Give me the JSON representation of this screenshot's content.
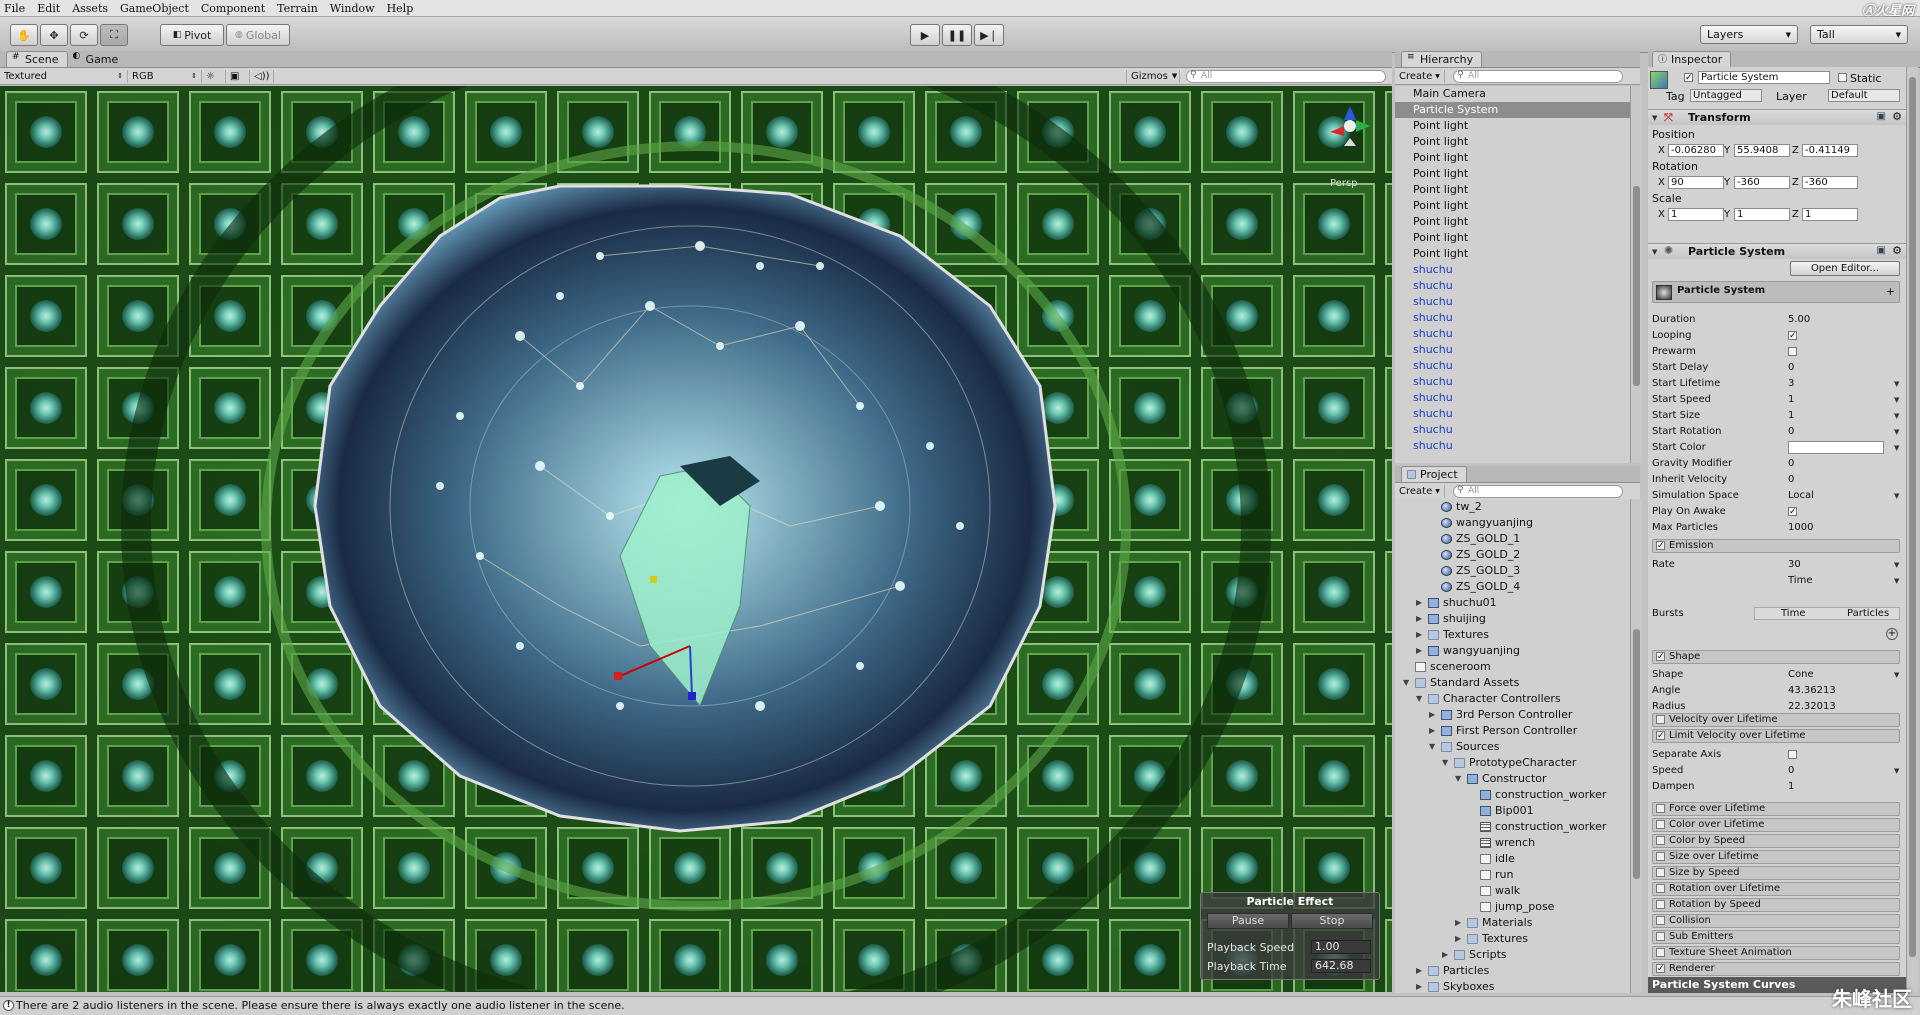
{
  "menu": [
    "File",
    "Edit",
    "Assets",
    "GameObject",
    "Component",
    "Terrain",
    "Window",
    "Help"
  ],
  "watermark_top": "Ⓐ火星网",
  "toolbar": {
    "pivot": "Pivot",
    "global": "Global",
    "layers": "Layers",
    "layout": "Tall"
  },
  "scene_tabs": {
    "scene": "Scene",
    "game": "Game"
  },
  "scene_bar": {
    "render": "Textured",
    "color": "RGB",
    "gizmos": "Gizmos",
    "search": "All",
    "persp": "Persp"
  },
  "hierarchy": {
    "title": "Hierarchy",
    "create": "Create",
    "search": "All",
    "items": [
      {
        "label": "Main Camera",
        "state": ""
      },
      {
        "label": "Particle System",
        "state": "sel"
      },
      {
        "label": "Point light",
        "state": ""
      },
      {
        "label": "Point light",
        "state": ""
      },
      {
        "label": "Point light",
        "state": ""
      },
      {
        "label": "Point light",
        "state": ""
      },
      {
        "label": "Point light",
        "state": ""
      },
      {
        "label": "Point light",
        "state": ""
      },
      {
        "label": "Point light",
        "state": ""
      },
      {
        "label": "Point light",
        "state": ""
      },
      {
        "label": "Point light",
        "state": ""
      },
      {
        "label": "shuchu",
        "state": "blue"
      },
      {
        "label": "shuchu",
        "state": "blue"
      },
      {
        "label": "shuchu",
        "state": "blue"
      },
      {
        "label": "shuchu",
        "state": "blue"
      },
      {
        "label": "shuchu",
        "state": "blue"
      },
      {
        "label": "shuchu",
        "state": "blue"
      },
      {
        "label": "shuchu",
        "state": "blue"
      },
      {
        "label": "shuchu",
        "state": "blue"
      },
      {
        "label": "shuchu",
        "state": "blue"
      },
      {
        "label": "shuchu",
        "state": "blue"
      },
      {
        "label": "shuchu",
        "state": "blue"
      },
      {
        "label": "shuchu",
        "state": "blue"
      }
    ]
  },
  "project": {
    "title": "Project",
    "create": "Create",
    "search": "All",
    "items": [
      {
        "label": "tw_2",
        "indent": 2,
        "icon": "ball",
        "arrow": ""
      },
      {
        "label": "wangyuanjing",
        "indent": 2,
        "icon": "ball",
        "arrow": ""
      },
      {
        "label": "ZS_GOLD_1",
        "indent": 2,
        "icon": "ball",
        "arrow": ""
      },
      {
        "label": "ZS_GOLD_2",
        "indent": 2,
        "icon": "ball",
        "arrow": ""
      },
      {
        "label": "ZS_GOLD_3",
        "indent": 2,
        "icon": "ball",
        "arrow": ""
      },
      {
        "label": "ZS_GOLD_4",
        "indent": 2,
        "icon": "ball",
        "arrow": ""
      },
      {
        "label": "shuchu01",
        "indent": 1,
        "icon": "prefab",
        "arrow": "▶"
      },
      {
        "label": "shuijing",
        "indent": 1,
        "icon": "prefab",
        "arrow": "▶"
      },
      {
        "label": "Textures",
        "indent": 1,
        "icon": "folder",
        "arrow": "▶"
      },
      {
        "label": "wangyuanjing",
        "indent": 1,
        "icon": "prefab",
        "arrow": "▶"
      },
      {
        "label": "sceneroom",
        "indent": 0,
        "icon": "doc",
        "arrow": ""
      },
      {
        "label": "Standard Assets",
        "indent": 0,
        "icon": "folder",
        "arrow": "▼"
      },
      {
        "label": "Character Controllers",
        "indent": 1,
        "icon": "folder",
        "arrow": "▼"
      },
      {
        "label": "3rd Person Controller",
        "indent": 2,
        "icon": "prefab",
        "arrow": "▶"
      },
      {
        "label": "First Person Controller",
        "indent": 2,
        "icon": "prefab",
        "arrow": "▶"
      },
      {
        "label": "Sources",
        "indent": 2,
        "icon": "folder",
        "arrow": "▼"
      },
      {
        "label": "PrototypeCharacter",
        "indent": 3,
        "icon": "folder",
        "arrow": "▼"
      },
      {
        "label": "Constructor",
        "indent": 4,
        "icon": "prefab",
        "arrow": "▼"
      },
      {
        "label": "construction_worker",
        "indent": 5,
        "icon": "prefab",
        "arrow": ""
      },
      {
        "label": "Bip001",
        "indent": 5,
        "icon": "prefab",
        "arrow": ""
      },
      {
        "label": "construction_worker",
        "indent": 5,
        "icon": "grid3",
        "arrow": ""
      },
      {
        "label": "wrench",
        "indent": 5,
        "icon": "grid3",
        "arrow": ""
      },
      {
        "label": "idle",
        "indent": 5,
        "icon": "doc",
        "arrow": ""
      },
      {
        "label": "run",
        "indent": 5,
        "icon": "doc",
        "arrow": ""
      },
      {
        "label": "walk",
        "indent": 5,
        "icon": "doc",
        "arrow": ""
      },
      {
        "label": "jump_pose",
        "indent": 5,
        "icon": "doc",
        "arrow": ""
      },
      {
        "label": "Materials",
        "indent": 4,
        "icon": "folder",
        "arrow": "▶"
      },
      {
        "label": "Textures",
        "indent": 4,
        "icon": "folder",
        "arrow": "▶"
      },
      {
        "label": "Scripts",
        "indent": 3,
        "icon": "folder",
        "arrow": "▶"
      },
      {
        "label": "Particles",
        "indent": 1,
        "icon": "folder",
        "arrow": "▶"
      },
      {
        "label": "Skyboxes",
        "indent": 1,
        "icon": "folder",
        "arrow": "▶"
      }
    ]
  },
  "inspector": {
    "title": "Inspector",
    "object_name": "Particle System",
    "static_label": "Static",
    "tag_label": "Tag",
    "tag_value": "Untagged",
    "layer_label": "Layer",
    "layer_value": "Default",
    "transform": {
      "title": "Transform",
      "position_label": "Position",
      "rotation_label": "Rotation",
      "scale_label": "Scale",
      "axes": [
        "X",
        "Y",
        "Z"
      ],
      "position": [
        "-0.06280",
        "55.9408",
        "-0.41149"
      ],
      "rotation": [
        "90",
        "-360",
        "-360"
      ],
      "scale": [
        "1",
        "1",
        "1"
      ]
    },
    "particle": {
      "title": "Particle System",
      "open_editor": "Open Editor...",
      "sub_title": "Particle System",
      "props": [
        {
          "label": "Duration",
          "value": "5.00",
          "kind": "text"
        },
        {
          "label": "Looping",
          "value": "✓",
          "kind": "check"
        },
        {
          "label": "Prewarm",
          "value": "",
          "kind": "check"
        },
        {
          "label": "Start Delay",
          "value": "0",
          "kind": "text"
        },
        {
          "label": "Start Lifetime",
          "value": "3",
          "kind": "drop"
        },
        {
          "label": "Start Speed",
          "value": "1",
          "kind": "drop"
        },
        {
          "label": "Start Size",
          "value": "1",
          "kind": "drop"
        },
        {
          "label": "Start Rotation",
          "value": "0",
          "kind": "drop"
        },
        {
          "label": "Start Color",
          "value": "",
          "kind": "color"
        },
        {
          "label": "Gravity Modifier",
          "value": "0",
          "kind": "text"
        },
        {
          "label": "Inherit Velocity",
          "value": "0",
          "kind": "text"
        },
        {
          "label": "Simulation Space",
          "value": "Local",
          "kind": "drop"
        },
        {
          "label": "Play On Awake",
          "value": "✓",
          "kind": "check"
        },
        {
          "label": "Max Particles",
          "value": "1000",
          "kind": "text"
        }
      ],
      "emission": {
        "title": "Emission",
        "rate_label": "Rate",
        "rate_value": "30",
        "rate_mode": "Time",
        "bursts_label": "Bursts",
        "bursts_col1": "Time",
        "bursts_col2": "Particles"
      },
      "shape": {
        "title": "Shape",
        "rows": [
          {
            "label": "Shape",
            "value": "Cone"
          },
          {
            "label": "Angle",
            "value": "43.36213"
          },
          {
            "label": "Radius",
            "value": "22.32013"
          }
        ]
      },
      "vel_module": "Velocity over Lifetime",
      "limit_module": "Limit Velocity over Lifetime",
      "limit_rows": [
        {
          "label": "Separate Axis",
          "value": ""
        },
        {
          "label": "Speed",
          "value": "0"
        },
        {
          "label": "Dampen",
          "value": "1"
        }
      ],
      "modules": [
        {
          "label": "Force over Lifetime",
          "checked": ""
        },
        {
          "label": "Color over Lifetime",
          "checked": ""
        },
        {
          "label": "Color by Speed",
          "checked": ""
        },
        {
          "label": "Size over Lifetime",
          "checked": ""
        },
        {
          "label": "Size by Speed",
          "checked": ""
        },
        {
          "label": "Rotation over Lifetime",
          "checked": ""
        },
        {
          "label": "Rotation by Speed",
          "checked": ""
        },
        {
          "label": "Collision",
          "checked": ""
        },
        {
          "label": "Sub Emitters",
          "checked": ""
        },
        {
          "label": "Texture Sheet Animation",
          "checked": ""
        },
        {
          "label": "Renderer",
          "checked": "✓"
        }
      ],
      "curves": "Particle System Curves"
    }
  },
  "particle_effect": {
    "title": "Particle Effect",
    "pause": "Pause",
    "stop": "Stop",
    "speed_label": "Playback Speed",
    "speed_value": "1.00",
    "time_label": "Playback Time",
    "time_value": "642.68"
  },
  "status": "There are 2 audio listeners in the scene. Please ensure there is always exactly one audio listener in the scene.",
  "watermark_bottom": "朱峰社区"
}
